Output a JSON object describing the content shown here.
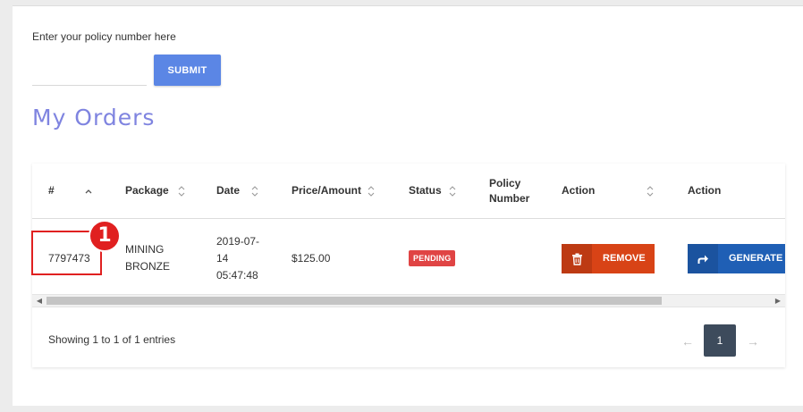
{
  "form": {
    "label": "Enter your policy number here",
    "input_value": "",
    "input_placeholder": "",
    "submit_label": "SUBMIT"
  },
  "page_title": "My Orders",
  "table": {
    "columns": [
      "#",
      "Package",
      "Date",
      "Price/Amount",
      "Status",
      "Policy Number",
      "Action",
      "Action"
    ],
    "rows": [
      {
        "id": "7797473",
        "package": "MINING BRONZE",
        "date": "2019-07-14 05:47:48",
        "price": "$125.00",
        "status": "PENDING",
        "policy_number": "",
        "remove_label": "REMOVE",
        "generate_label": "GENERATE B"
      }
    ]
  },
  "footer": {
    "entries": "Showing 1 to 1 of 1 entries",
    "prev": "←",
    "next": "→",
    "current_page": "1"
  },
  "annotation": {
    "step": "1"
  },
  "colors": {
    "title": "#7f84e0",
    "submit": "#5b86e5",
    "pending": "#e04444",
    "remove": "#d84316",
    "generate": "#1f5fb5",
    "pager_active": "#3d4b5c",
    "annotation": "#e02020"
  },
  "icons": {
    "col_0_sort": "chevron-up-icon",
    "sortable": "sort-icon",
    "remove": "trash-icon",
    "generate": "share-arrow-icon"
  }
}
